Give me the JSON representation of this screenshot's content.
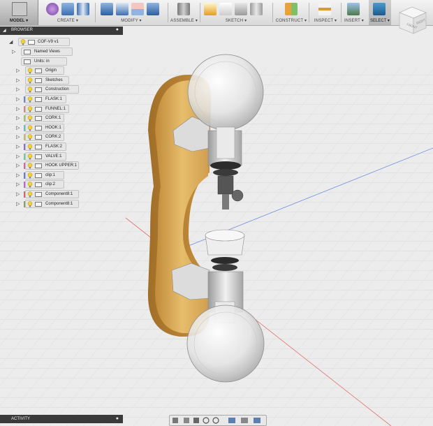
{
  "toolbar": {
    "workspace_label": "MODEL",
    "groups": {
      "create": "CREATE",
      "modify": "MODIFY",
      "assemble": "ASSEMBLE",
      "sketch": "SKETCH",
      "construct": "CONSTRUCT",
      "inspect": "INSPECT",
      "insert": "INSERT",
      "select": "SELECT"
    }
  },
  "view_cube": {
    "front": "FRONT",
    "right": "RIGHT"
  },
  "browser": {
    "title": "BROWSER",
    "root": "COF-V9 v1",
    "items": [
      {
        "label": "Named Views"
      },
      {
        "label": "Units: in"
      },
      {
        "label": "Origin"
      },
      {
        "label": "Sketches"
      },
      {
        "label": "Construction"
      },
      {
        "label": "FLASK:1",
        "color": "#6b88c9"
      },
      {
        "label": "FUNNEL:1",
        "color": "#c98a8a"
      },
      {
        "label": "CORK:1",
        "color": "#9ac36b"
      },
      {
        "label": "HOOK:1",
        "color": "#6bb8c9"
      },
      {
        "label": "CORK:2",
        "color": "#c9b86b"
      },
      {
        "label": "FLASK:2",
        "color": "#8a6bc9"
      },
      {
        "label": "VALVE:1",
        "color": "#6bc99a"
      },
      {
        "label": "HOOK UPPER:1",
        "color": "#c96b9a"
      },
      {
        "label": "clip:1",
        "color": "#6b7ac9"
      },
      {
        "label": "clip:2",
        "color": "#b86bc9"
      },
      {
        "label": "Component8:1",
        "color": "#c96b6b"
      },
      {
        "label": "Component8:1",
        "color": "#8aa06b"
      }
    ]
  },
  "activity": {
    "title": "ACTIVITY"
  }
}
